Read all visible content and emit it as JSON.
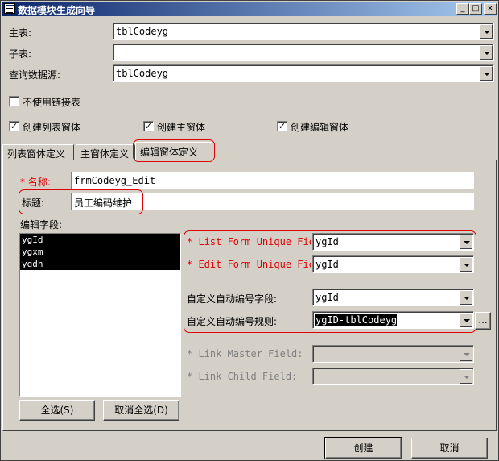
{
  "window": {
    "title": "数据模块生成向导",
    "controls": [
      "_",
      "□",
      "×"
    ]
  },
  "fields": {
    "main_table": {
      "label": "主表:",
      "value": "tblCodeyg"
    },
    "sub_table": {
      "label": "子表:",
      "value": ""
    },
    "query_source": {
      "label": "查询数据源:",
      "value": "tblCodeyg"
    }
  },
  "checkboxes": {
    "no_link_table": {
      "label": "不使用链接表",
      "checked": false
    },
    "create_list_form": {
      "label": "创建列表窗体",
      "checked": true
    },
    "create_main_form": {
      "label": "创建主窗体",
      "checked": true
    },
    "create_edit_form": {
      "label": "创建编辑窗体",
      "checked": true
    }
  },
  "tabs": [
    "列表窗体定义",
    "主窗体定义",
    "编辑窗体定义"
  ],
  "active_tab": "编辑窗体定义",
  "edit_tab": {
    "name_label": "* 名称:",
    "name_value": "frmCodeyg_Edit",
    "caption_label": "标题:",
    "caption_value": "员工编码维护",
    "fields_label": "编辑字段:",
    "fields_list": [
      "ygId",
      "ygxm",
      "ygdh"
    ],
    "list_unique_label": "* List Form Unique Fie",
    "list_unique_value": "ygId",
    "edit_unique_label": "* Edit Form Unique Fie",
    "edit_unique_value": "ygId",
    "auto_field_label": "自定义自动编号字段:",
    "auto_field_value": "ygId",
    "auto_rule_label": "自定义自动编号规则:",
    "auto_rule_value": "ygID-tblCodeyg",
    "ellipsis_label": "...",
    "link_master_label": "* Link Master Field:",
    "link_master_value": "",
    "link_child_label": "* Link Child Field:",
    "link_child_value": "",
    "select_all_label": "全选(S)",
    "deselect_all_label": "取消全选(D)"
  },
  "footer": {
    "create_label": "创建",
    "cancel_label": "取消"
  },
  "colors": {
    "title_start": "#0a246a",
    "title_end": "#a6caf0",
    "face": "#d4d0c8",
    "annotation": "#e00000"
  }
}
